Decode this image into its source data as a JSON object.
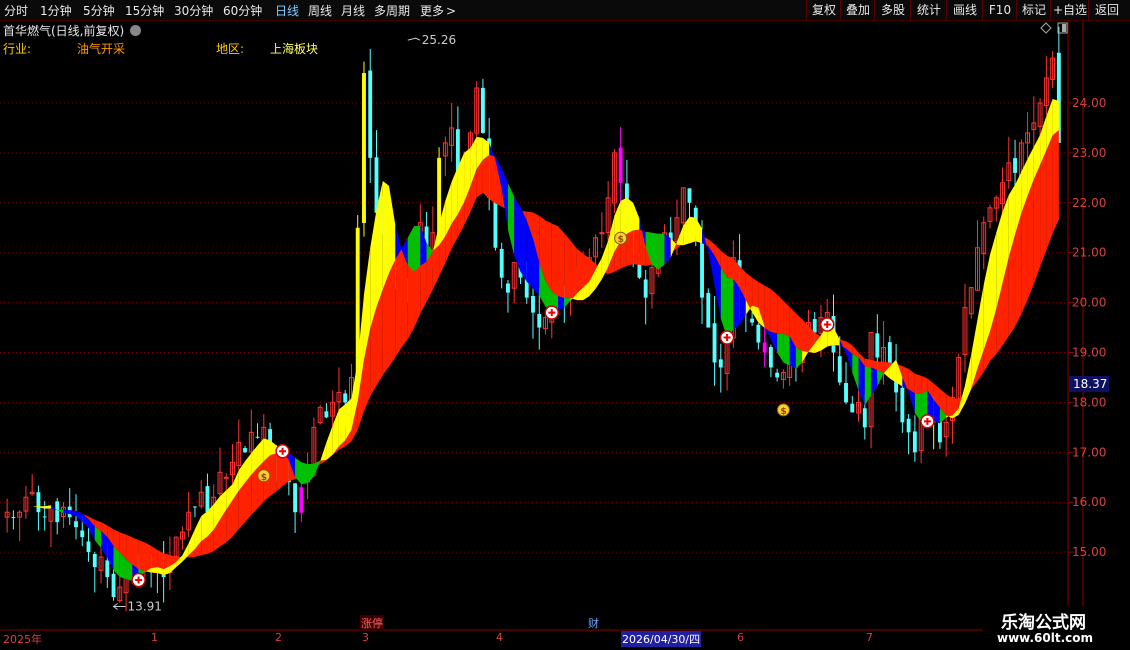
{
  "toolbar": {
    "periods": [
      "分时",
      "1分钟",
      "5分钟",
      "15分钟",
      "30分钟",
      "60分钟",
      "日线",
      "周线",
      "月线",
      "多周期",
      "更多"
    ],
    "active_period": "日线",
    "more_arrow": ">",
    "right_buttons": [
      "复权",
      "叠加",
      "多股",
      "统计",
      "画线",
      "F10",
      "标记",
      "+自选",
      "返回"
    ]
  },
  "header": {
    "stock_title": "首华燃气(日线,前复权)",
    "industry_label": "行业:",
    "industry_value": "油气开采",
    "region_label": "地区:",
    "region_value": "上海板块"
  },
  "colors": {
    "up": "#ff3232",
    "down": "#54ffff",
    "yellow": "#ffff00",
    "red_band": "#ff2200",
    "green_band": "#00c000",
    "blue_band": "#0000ff",
    "magenta": "#ff00ff",
    "axis": "#8b0000"
  },
  "chart_data": {
    "type": "candlestick",
    "ylim": [
      13.2,
      26.0
    ],
    "yticks": [
      "24.00",
      "23.00",
      "22.00",
      "21.00",
      "20.00",
      "19.00",
      "18.00",
      "17.00",
      "16.00",
      "15.00"
    ],
    "current_price": "18.37",
    "high_label": "25.26",
    "low_label": "13.91",
    "x_labels": [
      "2025年",
      "1",
      "2",
      "3",
      "4",
      "5",
      "6",
      "7"
    ],
    "events": [
      {
        "text": "涨停"
      },
      {
        "text": "财"
      },
      {
        "text": "2026/04/30/四"
      }
    ],
    "closes": [
      15.8,
      15.7,
      15.8,
      16.1,
      16.2,
      15.8,
      15.7,
      15.9,
      15.6,
      15.9,
      15.7,
      15.5,
      15.3,
      15.0,
      14.7,
      14.9,
      14.5,
      14.1,
      14.3,
      14.5,
      14.7,
      14.6,
      14.9,
      14.7,
      14.6,
      14.5,
      14.9,
      15.3,
      15.4,
      15.8,
      15.9,
      16.2,
      15.8,
      16.1,
      16.6,
      16.5,
      16.8,
      17.2,
      17.0,
      17.4,
      17.3,
      17.5,
      17.0,
      16.5,
      16.8,
      16.4,
      15.8,
      16.3,
      16.6,
      17.5,
      17.9,
      17.7,
      18.0,
      18.2,
      18.0,
      18.5,
      21.5,
      24.6,
      22.9,
      21.8,
      21.4,
      21.0,
      20.7,
      20.4,
      20.2,
      20.8,
      21.6,
      21.1,
      21.4,
      22.9,
      23.2,
      23.5,
      22.6,
      22.8,
      23.4,
      24.3,
      23.4,
      22.1,
      21.1,
      20.5,
      20.2,
      20.8,
      20.5,
      20.1,
      19.8,
      19.5,
      19.7,
      19.9,
      20.3,
      20.1,
      20.2,
      20.4,
      20.5,
      20.9,
      21.3,
      21.4,
      22.1,
      23.0,
      22.4,
      21.6,
      20.9,
      20.5,
      20.1,
      20.7,
      21.1,
      21.4,
      21.2,
      21.7,
      22.3,
      22.0,
      21.3,
      20.1,
      19.5,
      18.8,
      18.7,
      19.4,
      20.9,
      20.0,
      19.8,
      19.6,
      19.2,
      19.0,
      18.7,
      18.5,
      18.6,
      18.9,
      18.7,
      19.3,
      19.6,
      19.4,
      19.7,
      19.8,
      19.0,
      18.4,
      18.0,
      17.8,
      18.0,
      17.5,
      19.4,
      18.9,
      19.1,
      18.7,
      18.2,
      17.6,
      17.4,
      17.0,
      17.9,
      18.2,
      17.6,
      17.2,
      17.6,
      18.1,
      18.9,
      19.9,
      20.3,
      21.1,
      21.6,
      21.9,
      22.1,
      22.4,
      22.8,
      22.6,
      23.2,
      23.4,
      23.6,
      24.0,
      24.5,
      24.9,
      23.2
    ]
  },
  "watermark": {
    "line1": "乐淘公式网",
    "line2": "www.60lt.com"
  }
}
